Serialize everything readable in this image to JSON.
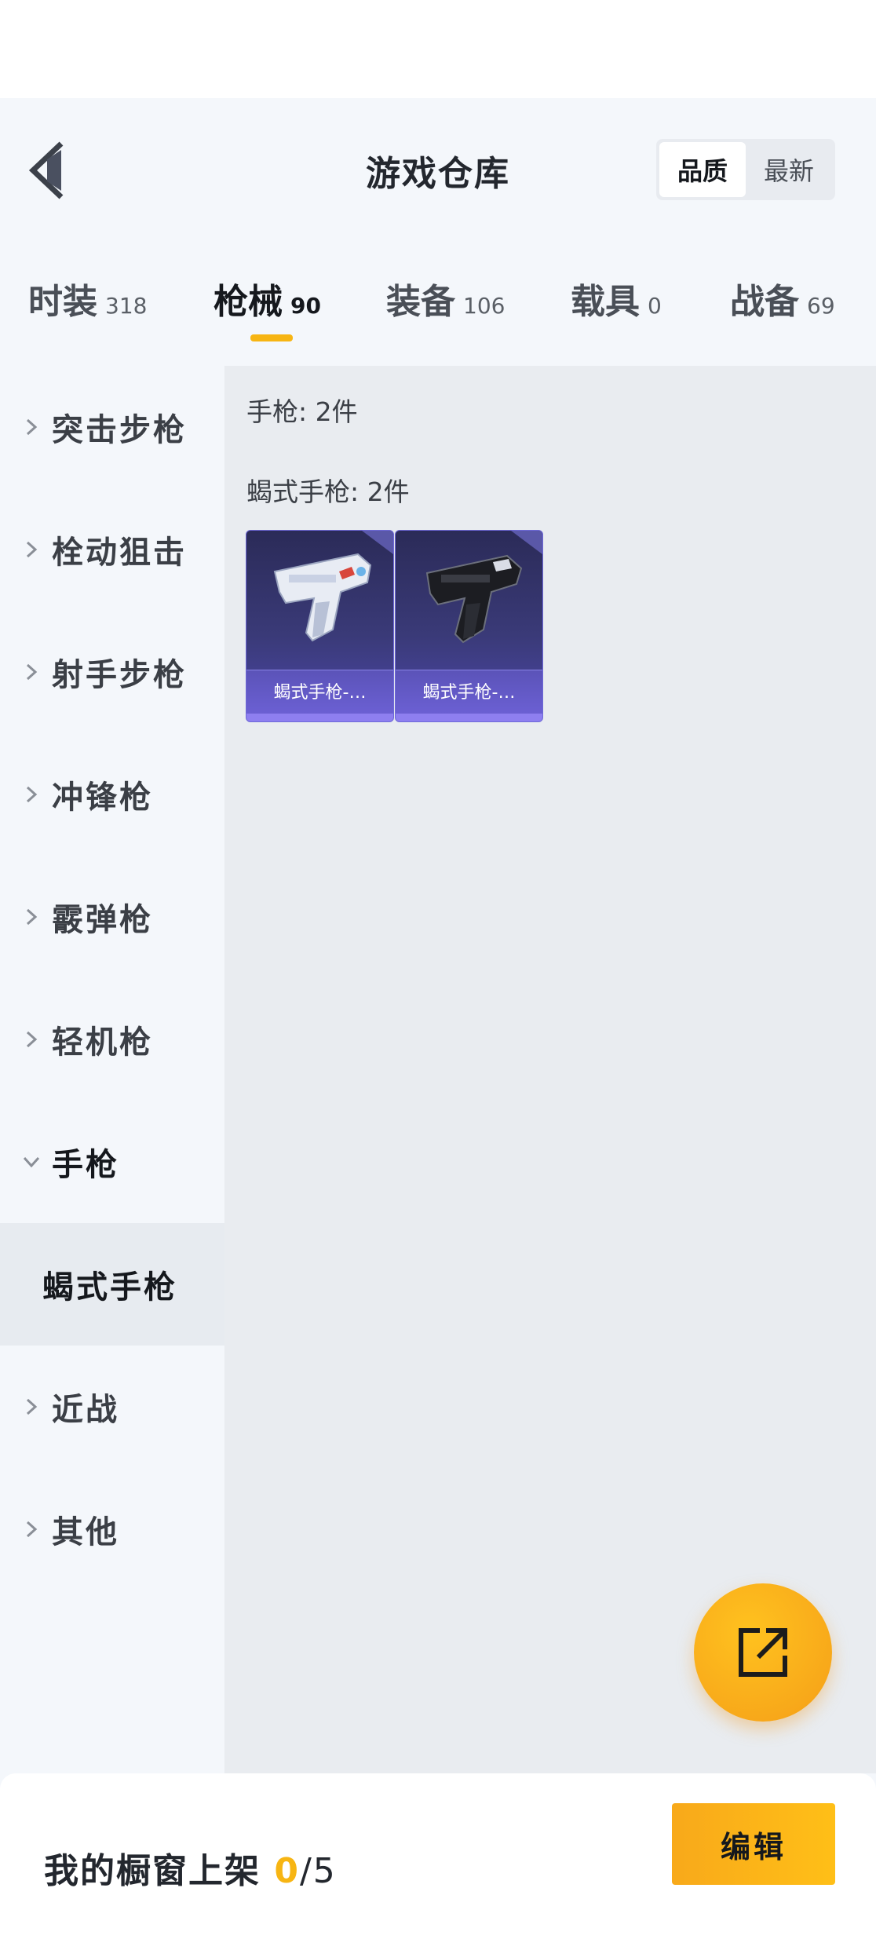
{
  "header": {
    "title": "游戏仓库",
    "sort_options": [
      "品质",
      "最新"
    ],
    "active_sort": "品质"
  },
  "tabs": [
    {
      "label": "时装",
      "count": "318"
    },
    {
      "label": "枪械",
      "count": "90",
      "active": true
    },
    {
      "label": "装备",
      "count": "106"
    },
    {
      "label": "载具",
      "count": "0"
    },
    {
      "label": "战备",
      "count": "69"
    }
  ],
  "sidebar": {
    "items": [
      {
        "label": "突击步枪",
        "icon": "chevron-right-icon"
      },
      {
        "label": "栓动狙击",
        "icon": "chevron-right-icon"
      },
      {
        "label": "射手步枪",
        "icon": "chevron-right-icon"
      },
      {
        "label": "冲锋枪",
        "icon": "chevron-right-icon"
      },
      {
        "label": "霰弹枪",
        "icon": "chevron-right-icon"
      },
      {
        "label": "轻机枪",
        "icon": "chevron-right-icon"
      },
      {
        "label": "手枪",
        "icon": "chevron-down-icon",
        "expanded": true
      },
      {
        "label": "近战",
        "icon": "chevron-right-icon"
      },
      {
        "label": "其他",
        "icon": "chevron-right-icon"
      }
    ],
    "subitem": {
      "label": "蝎式手枪",
      "selected": true
    }
  },
  "content": {
    "category_summary": "手枪: 2件",
    "group_summary": "蝎式手枪: 2件",
    "items": [
      {
        "name": "蝎式手枪-…",
        "finish": "white-chrome"
      },
      {
        "name": "蝎式手枪-…",
        "finish": "black"
      }
    ]
  },
  "fab": {
    "icon": "share-external-icon"
  },
  "bottom_bar": {
    "label": "我的橱窗上架",
    "count": "0",
    "total": "/5",
    "edit_label": "编辑"
  },
  "colors": {
    "accent": "#f7b513",
    "card_purple": "#3a3a78",
    "background": "#f4f7fb"
  }
}
